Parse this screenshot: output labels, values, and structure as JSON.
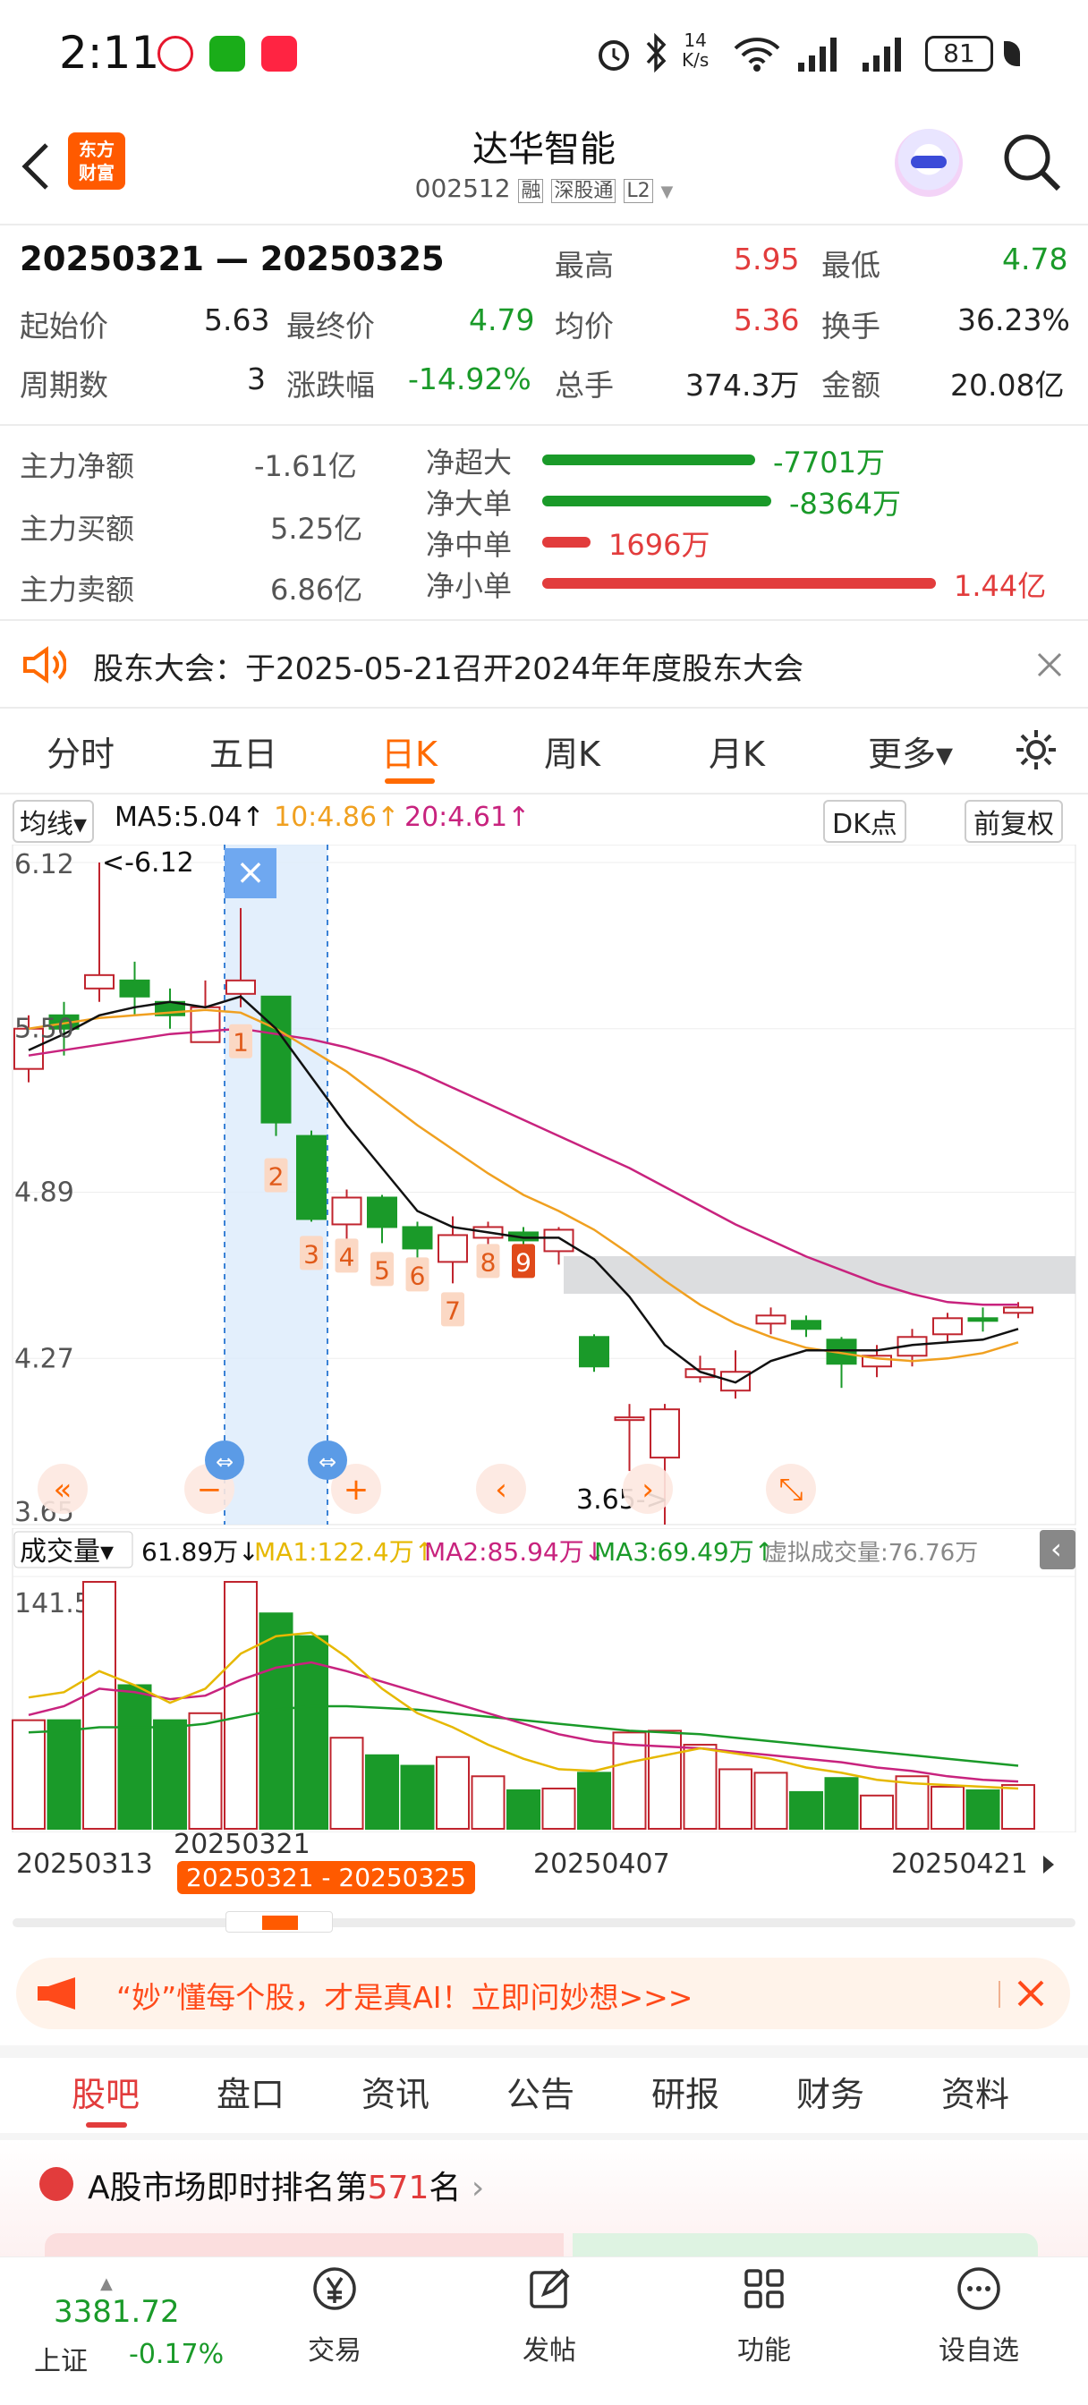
{
  "status_bar": {
    "time": "2:11",
    "net_speed_top": "14",
    "net_speed_bottom": "K/s",
    "battery": "81"
  },
  "header": {
    "title": "达华智能",
    "code": "002512",
    "tag1": "融",
    "tag2": "深股通",
    "tag3": "L2",
    "logo_line1": "东方",
    "logo_line2": "财富"
  },
  "summary": {
    "date_range": "20250321 — 20250325",
    "high_label": "最高",
    "high": "5.95",
    "low_label": "最低",
    "low": "4.78",
    "start_label": "起始价",
    "start": "5.63",
    "final_label": "最终价",
    "final": "4.79",
    "avg_label": "均价",
    "avg": "5.36",
    "turnover_label": "换手",
    "turnover": "36.23%",
    "periods_label": "周期数",
    "periods": "3",
    "change_label": "涨跌幅",
    "change": "-14.92%",
    "volume_label": "总手",
    "volume": "374.3万",
    "amount_label": "金额",
    "amount": "20.08亿"
  },
  "flow": {
    "net_label": "主力净额",
    "net": "-1.61亿",
    "buy_label": "主力买额",
    "buy": "5.25亿",
    "sell_label": "主力卖额",
    "sell": "6.86亿",
    "rows": [
      {
        "label": "净超大",
        "value": "-7701万",
        "color": "#1a9a29",
        "share": 0.4
      },
      {
        "label": "净大单",
        "value": "-8364万",
        "color": "#1a9a29",
        "share": 0.43
      },
      {
        "label": "净中单",
        "value": "1696万",
        "color": "#e23c3c",
        "share": 0.09
      },
      {
        "label": "净小单",
        "value": "1.44亿",
        "color": "#e23c3c",
        "share": 0.74
      }
    ]
  },
  "notice": {
    "text": "股东大会：于2025-05-21召开2024年年度股东大会"
  },
  "ktabs": [
    {
      "label": "分时"
    },
    {
      "label": "五日"
    },
    {
      "label": "日K"
    },
    {
      "label": "周K"
    },
    {
      "label": "月K"
    },
    {
      "label": "更多▾"
    }
  ],
  "legend": {
    "selector": "均线▾",
    "ma5": "MA5:5.04↑",
    "ma10": "10:4.86↑",
    "ma20": "20:4.61↑",
    "dk": "DK点",
    "fq": "前复权"
  },
  "price_axis": {
    "p1": "6.12",
    "p2": "5.50",
    "p3": "4.89",
    "p4": "4.27",
    "p5": "3.65",
    "max_note": "<-6.12",
    "min_note": "3.65->"
  },
  "markers": [
    "1",
    "2",
    "3",
    "4",
    "5",
    "6",
    "7",
    "8",
    "9"
  ],
  "vol_legend": {
    "selector": "成交量▾",
    "vol": "61.89万↓",
    "ma1": "MA1:122.4万↑",
    "ma2": "MA2:85.94万↓",
    "ma3": "MA3:69.49万↑",
    "virtual": "虚拟成交量:76.76万",
    "max": "141.5万"
  },
  "date_axis": {
    "d1": "20250313",
    "d2": "20250321",
    "d3": "20250407",
    "d4": "20250421",
    "range": "20250321 - 20250325"
  },
  "chart_data": {
    "type": "candlestick",
    "ylim": [
      3.65,
      6.12
    ],
    "candles": [
      {
        "o": 5.35,
        "c": 5.5,
        "h": 5.55,
        "l": 5.3
      },
      {
        "o": 5.55,
        "c": 5.5,
        "h": 5.6,
        "l": 5.4
      },
      {
        "o": 5.65,
        "c": 5.7,
        "h": 6.12,
        "l": 5.6
      },
      {
        "o": 5.68,
        "c": 5.62,
        "h": 5.75,
        "l": 5.55
      },
      {
        "o": 5.6,
        "c": 5.55,
        "h": 5.65,
        "l": 5.5
      },
      {
        "o": 5.45,
        "c": 5.58,
        "h": 5.68,
        "l": 5.45
      },
      {
        "o": 5.63,
        "c": 5.68,
        "h": 5.95,
        "l": 5.58
      },
      {
        "o": 5.62,
        "c": 5.15,
        "h": 5.62,
        "l": 5.1
      },
      {
        "o": 5.1,
        "c": 4.79,
        "h": 5.12,
        "l": 4.78
      },
      {
        "o": 4.77,
        "c": 4.87,
        "h": 4.9,
        "l": 4.7
      },
      {
        "o": 4.87,
        "c": 4.76,
        "h": 4.88,
        "l": 4.7
      },
      {
        "o": 4.76,
        "c": 4.68,
        "h": 4.78,
        "l": 4.6
      },
      {
        "o": 4.63,
        "c": 4.73,
        "h": 4.8,
        "l": 4.55
      },
      {
        "o": 4.72,
        "c": 4.76,
        "h": 4.78,
        "l": 4.68
      },
      {
        "o": 4.74,
        "c": 4.71,
        "h": 4.76,
        "l": 4.64
      },
      {
        "o": 4.67,
        "c": 4.75,
        "h": 4.76,
        "l": 4.62
      },
      {
        "o": 4.35,
        "c": 4.24,
        "h": 4.36,
        "l": 4.22
      },
      {
        "o": 4.05,
        "c": 4.05,
        "h": 4.1,
        "l": 3.85
      },
      {
        "o": 3.9,
        "c": 4.08,
        "h": 4.1,
        "l": 3.65
      },
      {
        "o": 4.2,
        "c": 4.23,
        "h": 4.28,
        "l": 4.18
      },
      {
        "o": 4.15,
        "c": 4.22,
        "h": 4.3,
        "l": 4.12
      },
      {
        "o": 4.4,
        "c": 4.43,
        "h": 4.46,
        "l": 4.36
      },
      {
        "o": 4.41,
        "c": 4.38,
        "h": 4.43,
        "l": 4.35
      },
      {
        "o": 4.34,
        "c": 4.25,
        "h": 4.35,
        "l": 4.16
      },
      {
        "o": 4.24,
        "c": 4.28,
        "h": 4.32,
        "l": 4.2
      },
      {
        "o": 4.28,
        "c": 4.35,
        "h": 4.38,
        "l": 4.24
      },
      {
        "o": 4.36,
        "c": 4.42,
        "h": 4.44,
        "l": 4.33
      },
      {
        "o": 4.42,
        "c": 4.41,
        "h": 4.46,
        "l": 4.37
      },
      {
        "o": 4.44,
        "c": 4.46,
        "h": 4.48,
        "l": 4.42
      }
    ],
    "ma5": [
      5.42,
      5.48,
      5.55,
      5.58,
      5.6,
      5.58,
      5.62,
      5.5,
      5.32,
      5.14,
      4.98,
      4.82,
      4.76,
      4.74,
      4.72,
      4.72,
      4.64,
      4.5,
      4.32,
      4.22,
      4.18,
      4.26,
      4.3,
      4.3,
      4.3,
      4.32,
      4.33,
      4.34,
      4.38
    ],
    "ma10": [
      5.5,
      5.52,
      5.54,
      5.55,
      5.56,
      5.57,
      5.56,
      5.5,
      5.42,
      5.34,
      5.24,
      5.14,
      5.05,
      4.96,
      4.88,
      4.82,
      4.75,
      4.66,
      4.56,
      4.47,
      4.4,
      4.35,
      4.31,
      4.29,
      4.27,
      4.26,
      4.27,
      4.29,
      4.33
    ],
    "ma20": [
      5.4,
      5.42,
      5.44,
      5.46,
      5.48,
      5.49,
      5.5,
      5.48,
      5.46,
      5.43,
      5.39,
      5.34,
      5.28,
      5.22,
      5.16,
      5.1,
      5.04,
      4.98,
      4.91,
      4.84,
      4.77,
      4.71,
      4.65,
      4.6,
      4.55,
      4.51,
      4.48,
      4.47,
      4.47
    ],
    "volumes": [
      62,
      62,
      141,
      82,
      62,
      66,
      141,
      123,
      110,
      52,
      42,
      36,
      41,
      30,
      22,
      23,
      32,
      55,
      56,
      48,
      34,
      32,
      21,
      29,
      19,
      30,
      24,
      22,
      25
    ],
    "vol_ma1": [
      75,
      78,
      90,
      82,
      72,
      80,
      100,
      110,
      112,
      98,
      80,
      66,
      58,
      48,
      40,
      34,
      33,
      38,
      42,
      46,
      43,
      40,
      35,
      32,
      28,
      26,
      25,
      24,
      23
    ],
    "vol_ma2": [
      65,
      70,
      80,
      78,
      74,
      76,
      85,
      92,
      95,
      90,
      84,
      78,
      72,
      66,
      60,
      54,
      50,
      48,
      47,
      46,
      44,
      42,
      40,
      38,
      35,
      33,
      30,
      28,
      27
    ],
    "vol_ma3": [
      55,
      56,
      58,
      58,
      58,
      60,
      64,
      68,
      70,
      70,
      69,
      68,
      66,
      64,
      62,
      60,
      58,
      56,
      55,
      54,
      52,
      50,
      48,
      46,
      44,
      42,
      40,
      38,
      36
    ]
  },
  "promo": {
    "text": "“妙”懂每个股，才是真AI！立即问妙想>>>"
  },
  "ftabs": [
    {
      "label": "股吧"
    },
    {
      "label": "盘口"
    },
    {
      "label": "资讯"
    },
    {
      "label": "公告"
    },
    {
      "label": "研报"
    },
    {
      "label": "财务"
    },
    {
      "label": "资料"
    }
  ],
  "rank": {
    "prefix": "A股市场即时排名第",
    "num": "571",
    "suffix": "名"
  },
  "bottom": {
    "index_value": "3381.72",
    "index_name": "上证",
    "index_change": "-0.17%",
    "trade": "交易",
    "post": "发帖",
    "func": "功能",
    "watch": "设自选"
  }
}
